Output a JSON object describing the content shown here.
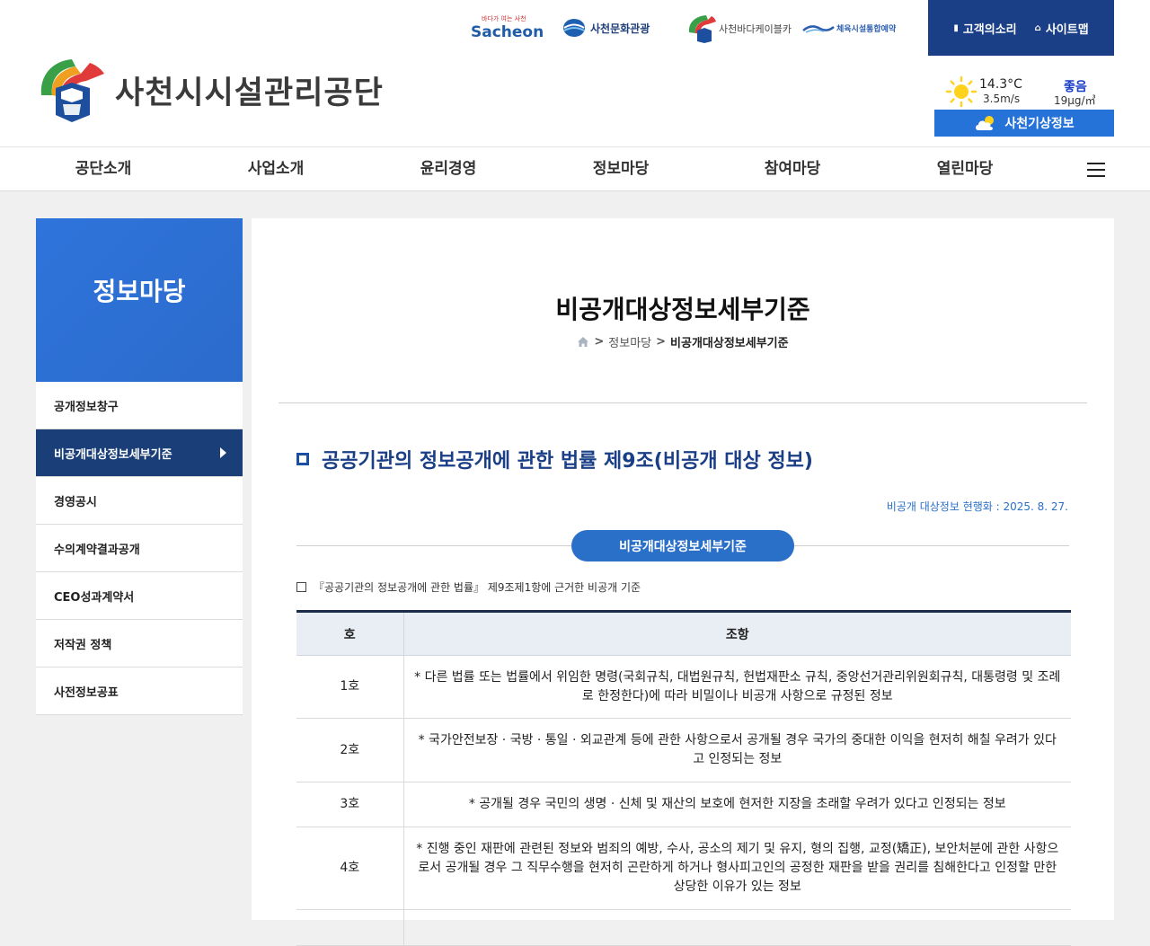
{
  "header": {
    "logo_text": "사천시시설관리공단",
    "family_sites": {
      "sacheon_sub": "바다가 여는 사천",
      "sacheon_main": "Sacheon",
      "culture": "사천문화관광",
      "cable": "사천바다케이블카",
      "sports": "체육시설통합예약"
    },
    "top_links": [
      {
        "label": "고객의소리",
        "icon": "document-icon"
      },
      {
        "label": "사이트맵",
        "icon": "home-icon"
      }
    ],
    "weather": {
      "temperature": "14.3°C",
      "wind": "3.5m/s",
      "air_quality": "좋음",
      "pm": "19μg/㎥",
      "button_label": "사천기상정보"
    }
  },
  "gnb": [
    "공단소개",
    "사업소개",
    "윤리경영",
    "정보마당",
    "참여마당",
    "열린마당"
  ],
  "lnb": {
    "title": "정보마당",
    "items": [
      {
        "label": "공개정보창구"
      },
      {
        "label": "비공개대상정보세부기준",
        "active": true
      },
      {
        "label": "경영공시"
      },
      {
        "label": "수의계약결과공개"
      },
      {
        "label": "CEO성과계약서"
      },
      {
        "label": "저작권 정책"
      },
      {
        "label": "사전정보공표"
      }
    ]
  },
  "content": {
    "page_title": "비공개대상정보세부기준",
    "breadcrumb": {
      "sep": ">",
      "section": "정보마당",
      "current": "비공개대상정보세부기준"
    },
    "section_title": "공공기관의 정보공개에 관한 법률 제9조(비공개 대상 정보)",
    "update_date": "비공개 대상정보 현행화 : 2025. 8. 27.",
    "pill_label": "비공개대상정보세부기준",
    "note": "『공공기관의 정보공개에 관한 법률』 제9조제1항에 근거한 비공개 기준",
    "table": {
      "headers": [
        "호",
        "조항"
      ],
      "rows": [
        {
          "no": "1호",
          "text": "* 다른 법률 또는 법률에서 위임한 명령(국회규칙, 대법원규칙, 헌법재판소 규칙, 중앙선거관리위원회규칙, 대통령령 및 조례로 한정한다)에 따라 비밀이나 비공개 사항으로 규정된 정보"
        },
        {
          "no": "2호",
          "text": "* 국가안전보장 · 국방 · 통일 · 외교관계 등에 관한 사항으로서 공개될 경우 국가의 중대한 이익을 현저히 해칠 우려가 있다고 인정되는 정보"
        },
        {
          "no": "3호",
          "text": "* 공개될 경우 국민의 생명 · 신체 및 재산의 보호에 현저한 지장을 초래할 우려가 있다고 인정되는 정보"
        },
        {
          "no": "4호",
          "text": "* 진행 중인 재판에 관련된 정보와 범죄의 예방, 수사, 공소의 제기 및 유지, 형의 집행, 교정(矯正), 보안처분에 관한 사항으로서 공개될 경우 그 직무수행을 현저히 곤란하게 하거나 형사피고인의 공정한 재판을 받을 권리를 침해한다고 인정할 만한 상당한 이유가 있는 정보"
        }
      ]
    }
  }
}
